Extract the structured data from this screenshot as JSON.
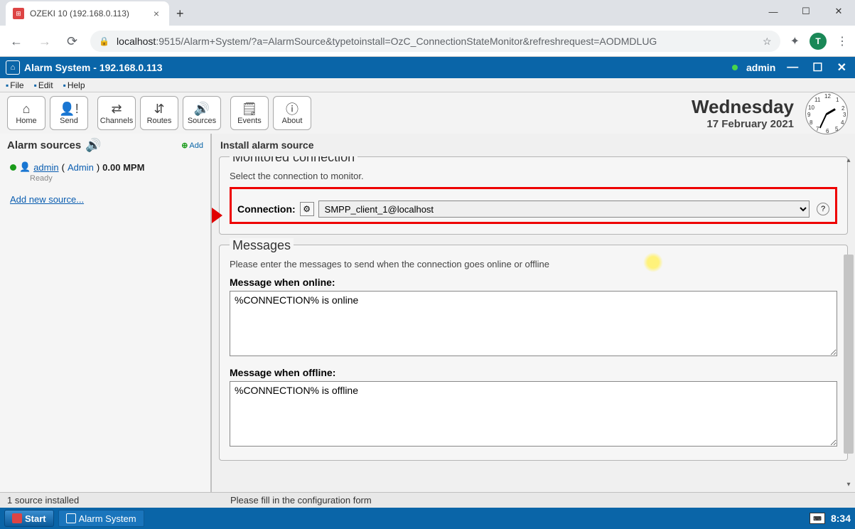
{
  "browser": {
    "tab_title": "OZEKI 10 (192.168.0.113)",
    "url_host": "localhost",
    "url_port": ":9515",
    "url_path": "/Alarm+System/?a=AlarmSource&typetoinstall=OzC_ConnectionStateMonitor&refreshrequest=AODMDLUG",
    "avatar_letter": "T"
  },
  "window_controls": {
    "min": "—",
    "max": "☐",
    "close": "✕"
  },
  "app_header": {
    "title": "Alarm System - 192.168.0.113",
    "user": "admin",
    "min": "—",
    "max": "☐",
    "close": "✕"
  },
  "menus": {
    "file": "File",
    "edit": "Edit",
    "help": "Help"
  },
  "toolbar": {
    "home": "Home",
    "send": "Send",
    "channels": "Channels",
    "routes": "Routes",
    "sources": "Sources",
    "events": "Events",
    "about": "About"
  },
  "date": {
    "day": "Wednesday",
    "date": "17 February 2021"
  },
  "sidebar": {
    "title": "Alarm sources",
    "add_label": "Add",
    "source": {
      "name": "admin",
      "role": "Admin",
      "mpm": "0.00 MPM",
      "status": "Ready"
    },
    "add_new": "Add new source..."
  },
  "form": {
    "title": "Install alarm source",
    "fs1_legend": "Monitored connection",
    "fs1_desc": "Select the connection to monitor.",
    "conn_label": "Connection:",
    "conn_value": "SMPP_client_1@localhost",
    "fs2_legend": "Messages",
    "fs2_desc": "Please enter the messages to send when the connection goes online or offline",
    "online_label": "Message when online:",
    "online_value": "%CONNECTION% is online",
    "offline_label": "Message when offline:",
    "offline_value": "%CONNECTION% is offline"
  },
  "status": {
    "left": "1 source installed",
    "right": "Please fill in the configuration form"
  },
  "taskbar": {
    "start": "Start",
    "task1": "Alarm System",
    "time": "8:34"
  }
}
